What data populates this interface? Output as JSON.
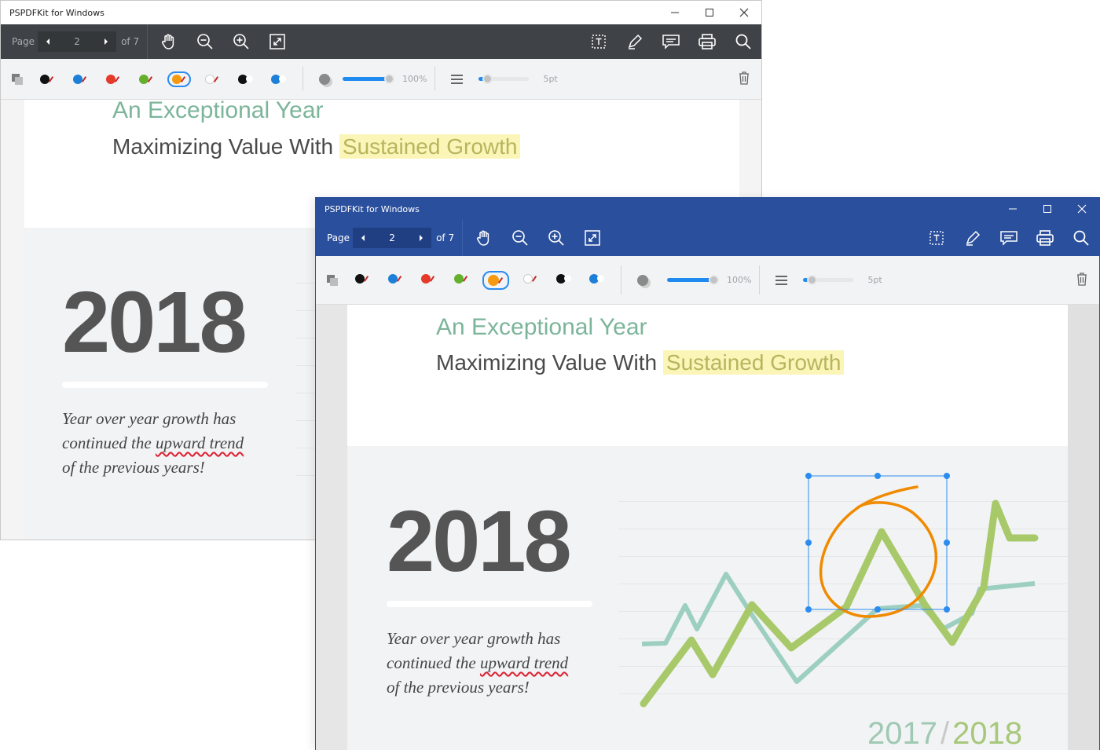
{
  "app_title": "PSPDFKit for Windows",
  "pager": {
    "label": "Page",
    "current": "2",
    "total": "of 7"
  },
  "zoom_percent": "100%",
  "stroke_size": "5pt",
  "colors": {
    "back_titlebar": "#ffffff",
    "back_toolbar": "#3f4347",
    "front_titlebar": "#2a4f9c",
    "accent": "#1f8bf0",
    "heading_green": "#7cb59a",
    "highlight_yellow": "#fbf5b8",
    "series_line_green": "#a8c96a",
    "series_line_teal": "#9ccfc0",
    "ink_orange": "#f08a00"
  },
  "toolbar_icons": [
    "pan-hand-icon",
    "zoom-out-icon",
    "zoom-in-icon",
    "fit-page-icon",
    "text-select-icon",
    "signature-icon",
    "comment-icon",
    "print-icon",
    "search-icon"
  ],
  "swatches": [
    {
      "name": "black-ink",
      "color": "#111111",
      "selected": false
    },
    {
      "name": "blue-ink",
      "color": "#1e7fd8",
      "selected": false
    },
    {
      "name": "red-ink",
      "color": "#e53a2a",
      "selected": false
    },
    {
      "name": "green-ink",
      "color": "#64b02c",
      "selected": false
    },
    {
      "name": "orange-ink",
      "color": "#f59a10",
      "selected": true
    },
    {
      "name": "white-ink",
      "color": "#ffffff",
      "selected": false
    },
    {
      "name": "black-fill",
      "color": "#111111",
      "selected": false
    },
    {
      "name": "blue-fill",
      "color": "#1e7fd8",
      "selected": false
    }
  ],
  "opacity_level_fraction": 1.0,
  "stroke_level_fraction": 0.2,
  "document": {
    "heading": "An Exceptional Year",
    "subheading_prefix": "Maximizing Value With",
    "subheading_highlight": "Sustained Growth",
    "year": "2018",
    "para_line1": "Year over year growth has",
    "para_line2_prefix": "continued the",
    "para_line2_squiggle": "upward trend",
    "para_line3": "of the previous years!",
    "footer_year_a": "2017",
    "footer_slash": "/",
    "footer_year_b": "2018"
  }
}
